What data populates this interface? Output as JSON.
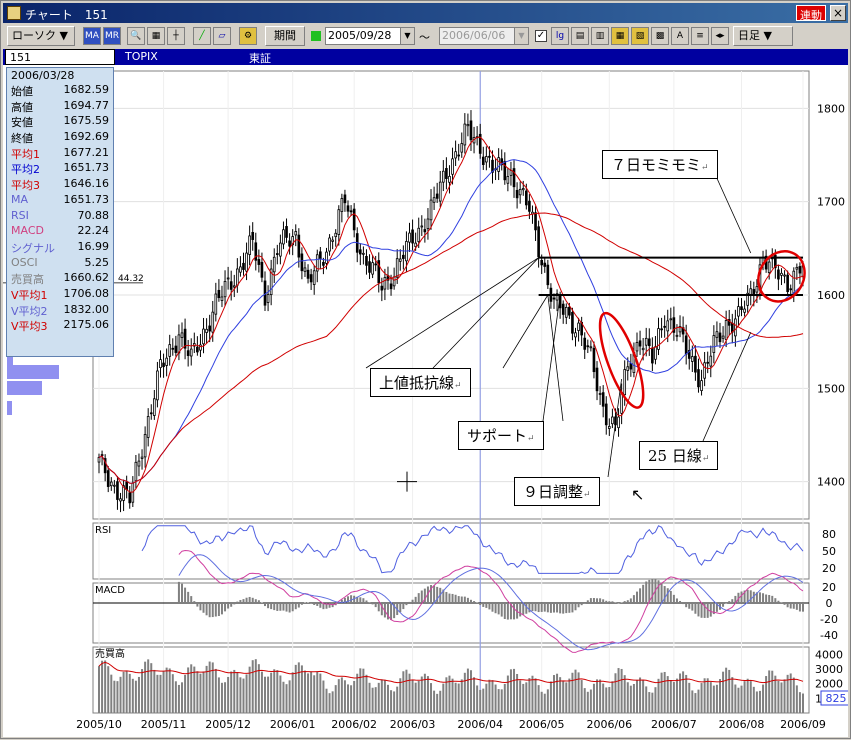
{
  "window": {
    "title": "チャート　151",
    "link_label": "連動",
    "close_label": "×"
  },
  "toolbar": {
    "type_label": "ローソク ▼",
    "period_label": "期間",
    "date_from": "2005/09/28",
    "tilde": "〜",
    "date_to": "2006/06/06",
    "interval_label": "日足 ▼",
    "icons": [
      "MA",
      "MRE",
      "zoom-icon",
      "scale-icon",
      "crosshair-icon",
      "pen-icon",
      "eraser-icon",
      "settings-icon"
    ]
  },
  "symbol_bar": {
    "code": "151",
    "name": "TOPIX",
    "market": "東証"
  },
  "info": {
    "date": "2006/03/28",
    "rows": [
      {
        "label": "始値",
        "value": "1682.59",
        "color": "#000000"
      },
      {
        "label": "高値",
        "value": "1694.77",
        "color": "#000000"
      },
      {
        "label": "安値",
        "value": "1675.59",
        "color": "#000000"
      },
      {
        "label": "終値",
        "value": "1692.69",
        "color": "#000000"
      },
      {
        "label": "平均1",
        "value": "1677.21",
        "color": "#d00000"
      },
      {
        "label": "平均2",
        "value": "1651.73",
        "color": "#0000d0"
      },
      {
        "label": "平均3",
        "value": "1646.16",
        "color": "#d00000"
      },
      {
        "label": "MA",
        "value": "1651.73",
        "color": "#6060d0"
      },
      {
        "label": "RSI",
        "value": "70.88",
        "color": "#6060d0"
      },
      {
        "label": "MACD",
        "value": "22.24",
        "color": "#d04080"
      },
      {
        "label": "シグナル",
        "value": "16.99",
        "color": "#6060d0"
      },
      {
        "label": "OSCI",
        "value": "5.25",
        "color": "#808080"
      },
      {
        "label": "売買高",
        "value": "1660.62",
        "color": "#808080"
      },
      {
        "label": "V平均1",
        "value": "1706.08",
        "color": "#d00000"
      },
      {
        "label": "V平均2",
        "value": "1832.00",
        "color": "#6060d0"
      },
      {
        "label": "V平均3",
        "value": "2175.06",
        "color": "#d00000"
      }
    ],
    "price_marker": "44.32"
  },
  "annotations": {
    "momi": "７日モミモミ",
    "resistance": "上値抵抗線",
    "support": "サポート",
    "adjust": "９日調整",
    "line25": "25 日線",
    "return_mark": "↵"
  },
  "panels": {
    "rsi_label": "RSI",
    "macd_label": "MACD",
    "volume_label": "売買高",
    "volume_current": "825"
  },
  "chart_data": {
    "type": "candlestick",
    "title": "",
    "x_ticks": [
      "2005/10",
      "2005/11",
      "2005/12",
      "2006/01",
      "2006/02",
      "2006/03",
      "2006/04",
      "2006/05",
      "2006/06",
      "2006/07",
      "2006/08",
      "2006/09"
    ],
    "price_ticks": [
      1400,
      1500,
      1600,
      1700,
      1800
    ],
    "price_range": [
      1360,
      1840
    ],
    "rsi_ticks": [
      20,
      50,
      80
    ],
    "macd_ticks": [
      -40,
      -20,
      0,
      20
    ],
    "volume_ticks": [
      1000,
      2000,
      3000,
      4000
    ],
    "close_anchors": [
      [
        0,
        1420
      ],
      [
        5,
        1395
      ],
      [
        10,
        1380
      ],
      [
        14,
        1440
      ],
      [
        20,
        1520
      ],
      [
        26,
        1560
      ],
      [
        30,
        1530
      ],
      [
        38,
        1590
      ],
      [
        44,
        1620
      ],
      [
        50,
        1655
      ],
      [
        54,
        1600
      ],
      [
        58,
        1650
      ],
      [
        64,
        1665
      ],
      [
        68,
        1610
      ],
      [
        74,
        1650
      ],
      [
        80,
        1700
      ],
      [
        86,
        1640
      ],
      [
        92,
        1610
      ],
      [
        96,
        1625
      ],
      [
        102,
        1660
      ],
      [
        108,
        1690
      ],
      [
        114,
        1740
      ],
      [
        120,
        1775
      ],
      [
        124,
        1760
      ],
      [
        128,
        1735
      ],
      [
        134,
        1730
      ],
      [
        140,
        1690
      ],
      [
        144,
        1640
      ],
      [
        148,
        1590
      ],
      [
        152,
        1580
      ],
      [
        156,
        1565
      ],
      [
        160,
        1530
      ],
      [
        164,
        1480
      ],
      [
        168,
        1455
      ],
      [
        172,
        1525
      ],
      [
        176,
        1555
      ],
      [
        180,
        1530
      ],
      [
        184,
        1580
      ],
      [
        188,
        1560
      ],
      [
        192,
        1535
      ],
      [
        196,
        1510
      ],
      [
        200,
        1545
      ],
      [
        204,
        1570
      ],
      [
        208,
        1575
      ],
      [
        212,
        1600
      ],
      [
        216,
        1640
      ],
      [
        220,
        1625
      ],
      [
        224,
        1615
      ],
      [
        228,
        1628
      ]
    ],
    "horizontal_lines": [
      1640,
      1600
    ]
  }
}
